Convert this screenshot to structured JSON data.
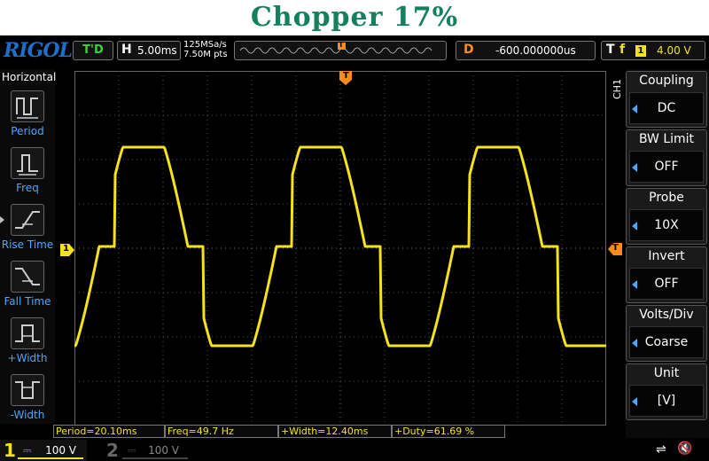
{
  "page_title": "Chopper 17%",
  "scope": {
    "brand": "RIGOL",
    "run_state": "T'D",
    "timebase": {
      "key": "H",
      "value": "5.00ms"
    },
    "sample_rate": "125MSa/s",
    "memory_depth": "7.50M pts",
    "trigger_marker": "T",
    "delay": {
      "key": "D",
      "value": "-600.000000us"
    },
    "trigger": {
      "key": "T",
      "slope": "f",
      "channel": "1",
      "level": "4.00 V"
    }
  },
  "left_menu": {
    "header": "Horizontal",
    "items": [
      {
        "label": "Period",
        "icon": "period-icon"
      },
      {
        "label": "Freq",
        "icon": "frequency-icon"
      },
      {
        "label": "Rise Time",
        "icon": "rise-time-icon"
      },
      {
        "label": "Fall Time",
        "icon": "fall-time-icon"
      },
      {
        "label": "+Width",
        "icon": "positive-width-icon"
      },
      {
        "label": "-Width",
        "icon": "negative-width-icon"
      }
    ]
  },
  "right_menu": {
    "channel_label": "CH1",
    "items": [
      {
        "title": "Coupling",
        "value": "DC"
      },
      {
        "title": "BW Limit",
        "value": "OFF"
      },
      {
        "title": "Probe",
        "value": "10X"
      },
      {
        "title": "Invert",
        "value": "OFF"
      },
      {
        "title": "Volts/Div",
        "value": "Coarse"
      },
      {
        "title": "Unit",
        "value": "[V]"
      }
    ]
  },
  "measurements": [
    "Period=20.10ms",
    "Freq=49.7 Hz",
    "+Width=12.40ms",
    "+Duty=61.69 %"
  ],
  "channels": [
    {
      "number": "1",
      "scale": "100 V",
      "active": true
    },
    {
      "number": "2",
      "scale": "100 V",
      "active": false
    }
  ],
  "ch1_marker": "1",
  "colors": {
    "ch1": "#f5e21b",
    "accent": "#4aa8ff",
    "trigger": "#ff8c1a",
    "title": "#15805c"
  }
}
